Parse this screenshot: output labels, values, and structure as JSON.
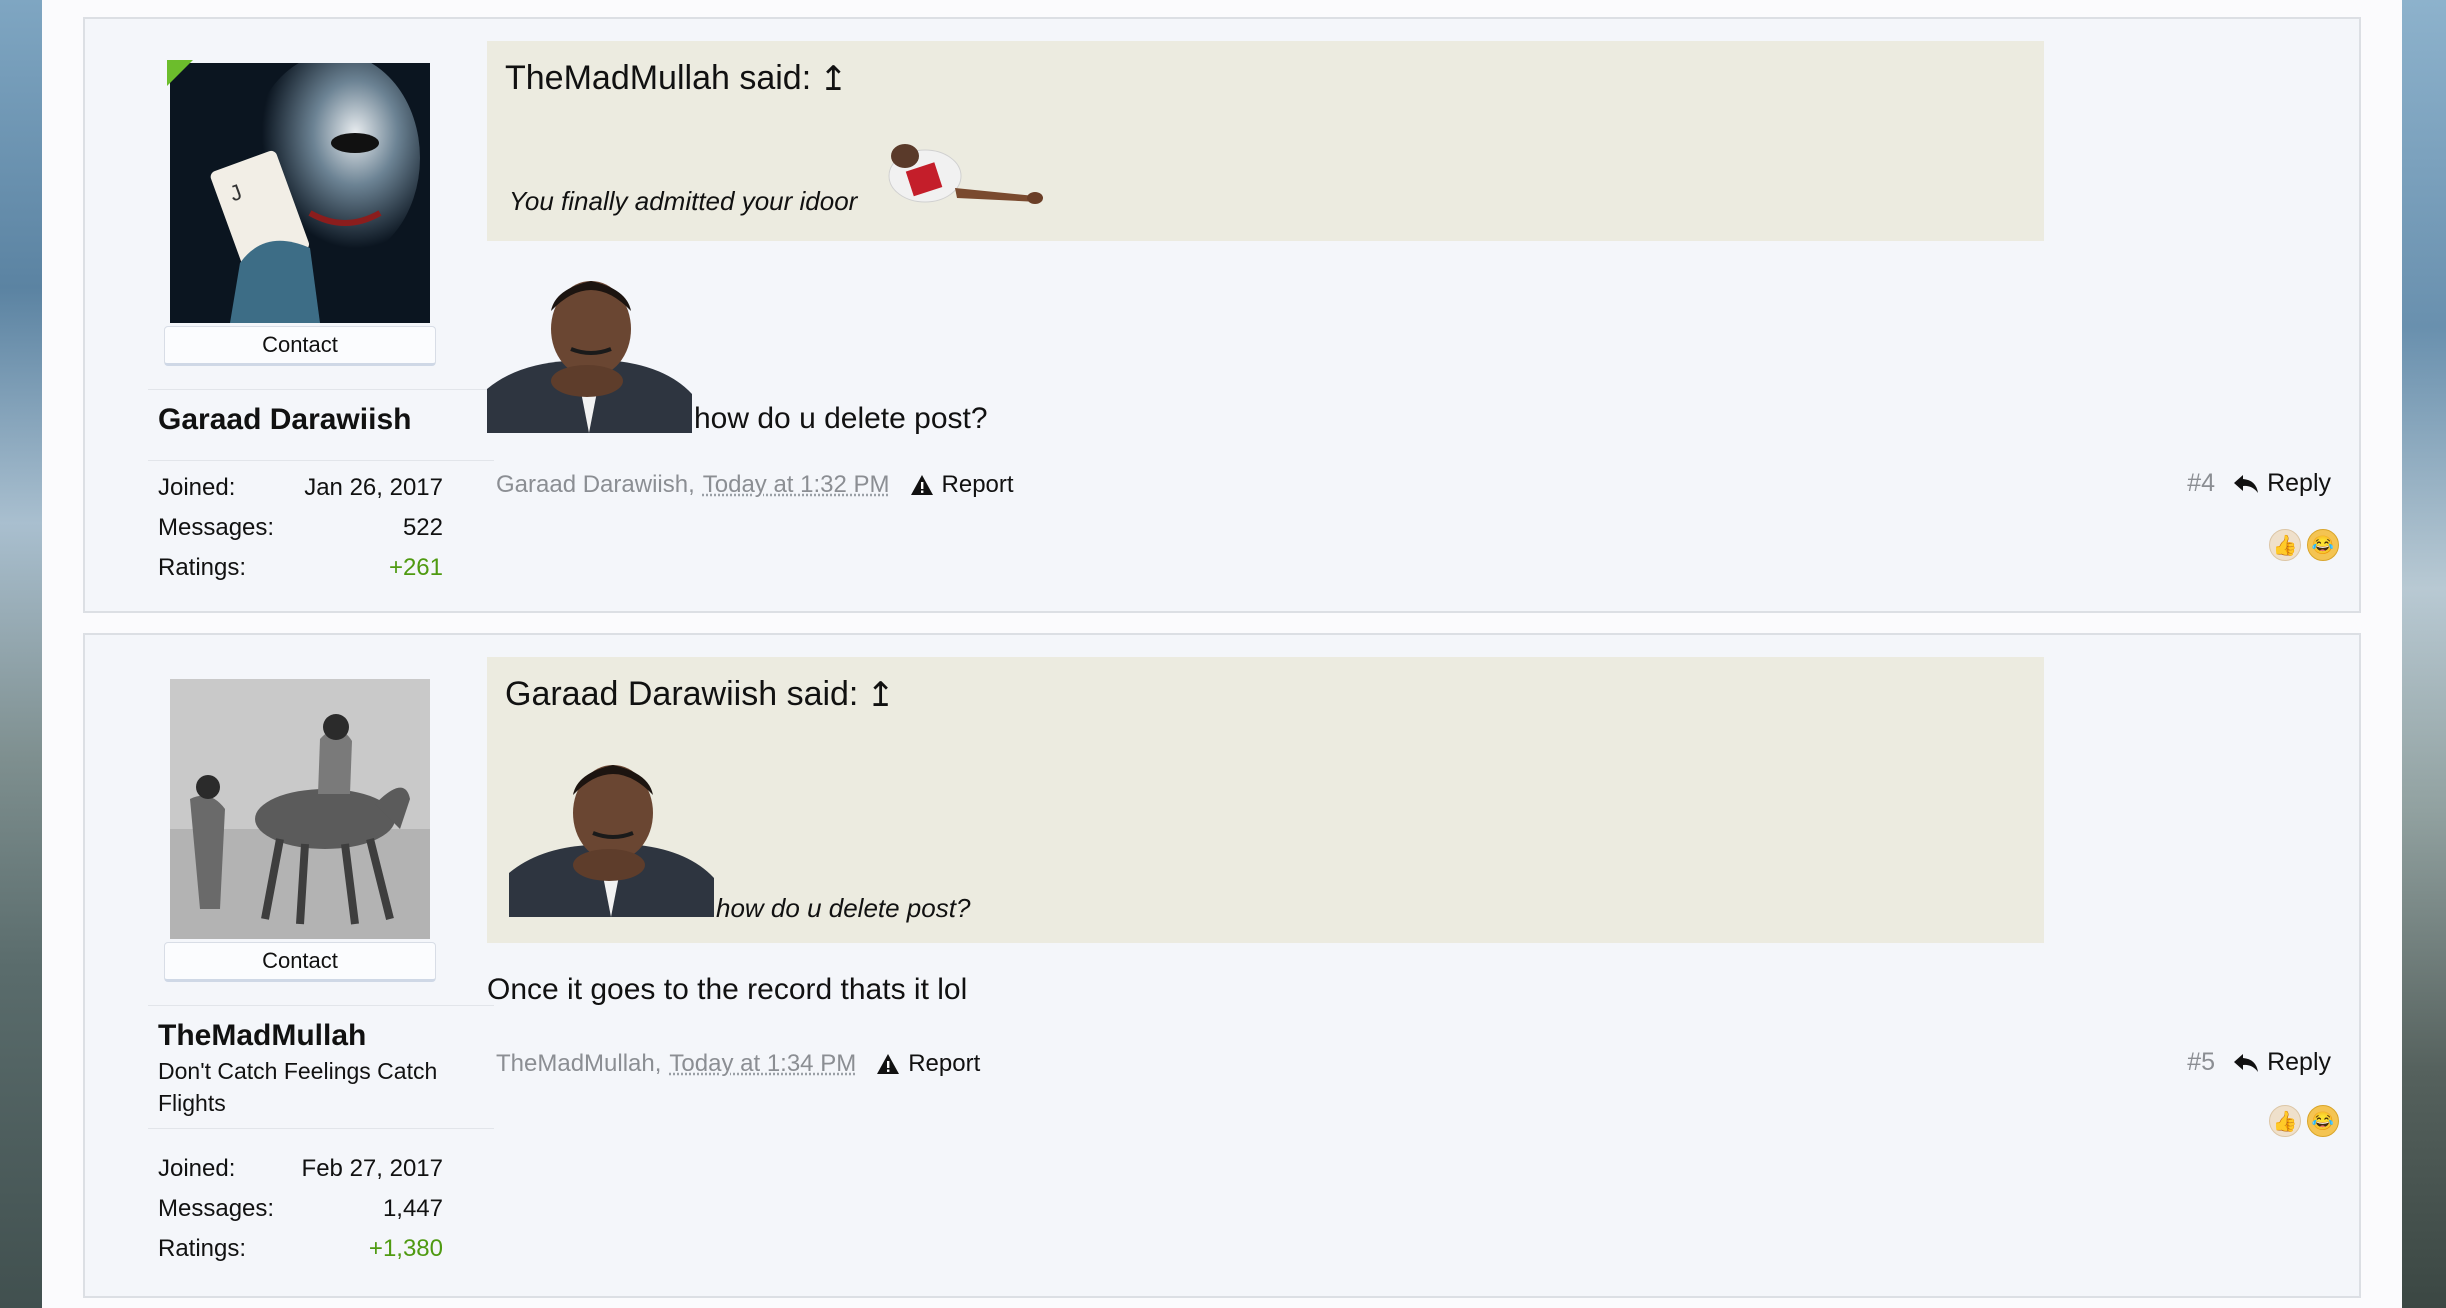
{
  "posts": [
    {
      "author": {
        "name": "Garaad Darawiish",
        "contact_label": "Contact",
        "avatar_icon": "joker-avatar",
        "online": true,
        "stats": [
          {
            "label": "Joined:",
            "value": "Jan 26, 2017"
          },
          {
            "label": "Messages:",
            "value": "522"
          },
          {
            "label": "Ratings:",
            "value": "+261"
          }
        ]
      },
      "quote": {
        "header": "TheMadMullah said:",
        "arrow_glyph": "↥",
        "text": "You finally admitted your idoor",
        "image_icon": "basketball-player-gif"
      },
      "message": {
        "text": "how do u delete post?",
        "image_icon": "thinking-man-image"
      },
      "meta": {
        "author": "Garaad Darawiish,",
        "time": "Today at 1:32 PM",
        "report_label": "Report"
      },
      "number": "#4",
      "reply_label": "Reply"
    },
    {
      "author": {
        "name": "TheMadMullah",
        "title": "Don't Catch Feelings Catch Flights",
        "contact_label": "Contact",
        "avatar_icon": "camel-rider-avatar",
        "online": false,
        "stats": [
          {
            "label": "Joined:",
            "value": "Feb 27, 2017"
          },
          {
            "label": "Messages:",
            "value": "1,447"
          },
          {
            "label": "Ratings:",
            "value": "+1,380"
          }
        ]
      },
      "quote": {
        "header": "Garaad Darawiish said:",
        "arrow_glyph": "↥",
        "text": "how do u delete post?",
        "image_icon": "thinking-man-image"
      },
      "message": {
        "text": "Once it goes to the record thats it lol"
      },
      "meta": {
        "author": "TheMadMullah,",
        "time": "Today at 1:34 PM",
        "report_label": "Report"
      },
      "number": "#5",
      "reply_label": "Reply"
    }
  ],
  "colors": {
    "ratings_positive": "#4f9a11",
    "quote_bg": "#ecebe0",
    "post_bg": "#f4f6fa",
    "online": "#6cbd2c"
  }
}
